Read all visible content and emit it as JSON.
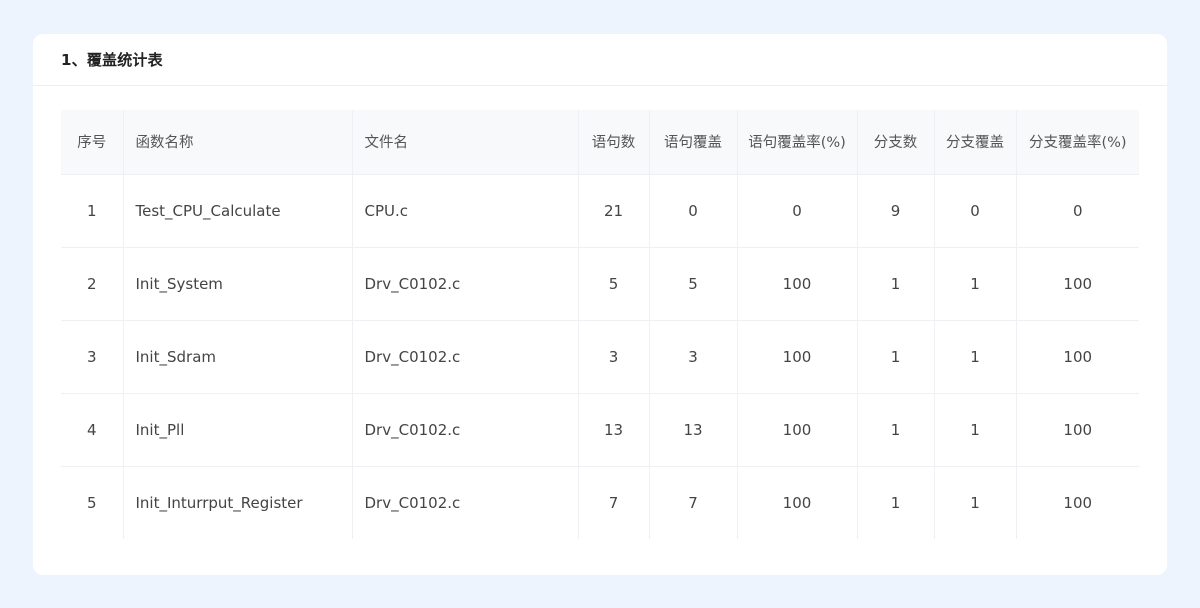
{
  "section": {
    "title": "1、覆盖统计表"
  },
  "table": {
    "headers": {
      "index": "序号",
      "function_name": "函数名称",
      "file_name": "文件名",
      "statements": "语句数",
      "statements_covered": "语句覆盖",
      "statement_coverage_rate": "语句覆盖率(%)",
      "branches": "分支数",
      "branches_covered": "分支覆盖",
      "branch_coverage_rate": "分支覆盖率(%)"
    },
    "rows": [
      {
        "index": "1",
        "function_name": "Test_CPU_Calculate",
        "file_name": "CPU.c",
        "statements": "21",
        "statements_covered": "0",
        "statement_coverage_rate": "0",
        "branches": "9",
        "branches_covered": "0",
        "branch_coverage_rate": "0"
      },
      {
        "index": "2",
        "function_name": "Init_System",
        "file_name": "Drv_C0102.c",
        "statements": "5",
        "statements_covered": "5",
        "statement_coverage_rate": "100",
        "branches": "1",
        "branches_covered": "1",
        "branch_coverage_rate": "100"
      },
      {
        "index": "3",
        "function_name": "Init_Sdram",
        "file_name": "Drv_C0102.c",
        "statements": "3",
        "statements_covered": "3",
        "statement_coverage_rate": "100",
        "branches": "1",
        "branches_covered": "1",
        "branch_coverage_rate": "100"
      },
      {
        "index": "4",
        "function_name": "Init_Pll",
        "file_name": "Drv_C0102.c",
        "statements": "13",
        "statements_covered": "13",
        "statement_coverage_rate": "100",
        "branches": "1",
        "branches_covered": "1",
        "branch_coverage_rate": "100"
      },
      {
        "index": "5",
        "function_name": "Init_Inturrput_Register",
        "file_name": "Drv_C0102.c",
        "statements": "7",
        "statements_covered": "7",
        "statement_coverage_rate": "100",
        "branches": "1",
        "branches_covered": "1",
        "branch_coverage_rate": "100"
      }
    ]
  }
}
